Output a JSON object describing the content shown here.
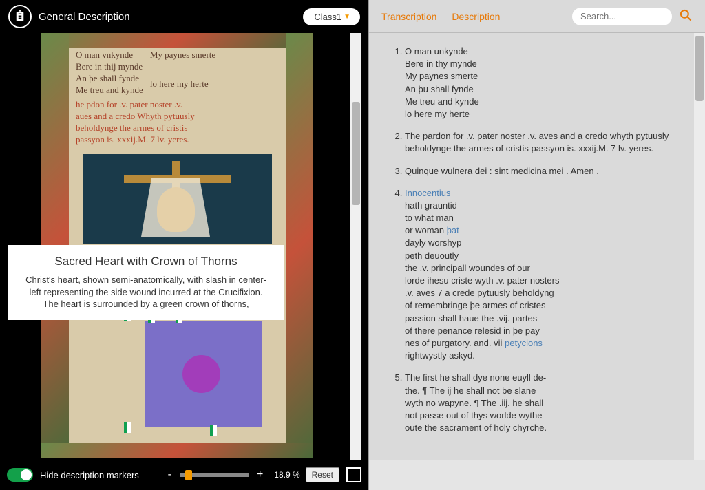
{
  "header": {
    "title": "General Description",
    "class_label": "Class1"
  },
  "tooltip": {
    "title": "Sacred Heart with Crown of Thorns",
    "body": "Christ's heart, shown semi-anatomically, with slash in center-left representing the side wound incurred at the Crucifixion. The heart is surrounded by a green crown of thorns,"
  },
  "manuscript_text": {
    "line1": "O man vnkynde",
    "line2": "Bere in thij mynde",
    "line3": "An þe shall fynde",
    "line4": "Me treu and kynde",
    "line1b": "My paynes smerte",
    "line2b": "lo here my herte",
    "rub1": "he pdon for .v. pater noster .v.",
    "rub2": "aues and a credo Whyth pytuusly",
    "rub3": "beholdynge the armes of cristis",
    "rub4": "passyon is. xxxij.M. 7 lv. yeres."
  },
  "footer": {
    "toggle_label": "Hide description markers",
    "zoom_pct": "18.9 %",
    "reset": "Reset",
    "minus": "-",
    "plus": "+"
  },
  "tabs": {
    "transcription": "Transcription",
    "description": "Description"
  },
  "search": {
    "placeholder": "Search..."
  },
  "transcription": {
    "item1": "O man unkynde\nBere in thy mynde\nMy paynes smerte\nAn þu shall fynde\nMe treu and kynde\nlo here my herte",
    "item2": "The pardon for .v. pater noster .v. aves and a credo whyth pytuusly beholdynge the armes of cristis passyon is. xxxij.M. 7 lv. yeres.",
    "item3": "Quinque wulnera dei : sint medicina mei . Amen .",
    "item4_link1": "Innocentius",
    "item4a": "hath grauntid\nto what man\nor woman ",
    "item4_link2": "þat",
    "item4b": "\ndayly worshyp\npeth deuoutly\nthe .v. principall woundes of our\nlorde ihesu criste wyth .v. pater nosters\n.v. aves 7 a crede pytuusly beholdyng\nof remembringe þe armes of cristes\npassion shall haue the .vij. partes\nof there penance relesid in þe pay\nnes of purgatory. and. vii ",
    "item4_link3": "petycions",
    "item4c": "\nrightwystly askyd.",
    "item5": "The first he shall dye none euyll de-\nthe. ¶ The ij he shall not be slane\nwyth no wapyne. ¶ The .iij. he shall\nnot passe out of thys worlde wythe\noute the sacrament of holy chyrche."
  }
}
